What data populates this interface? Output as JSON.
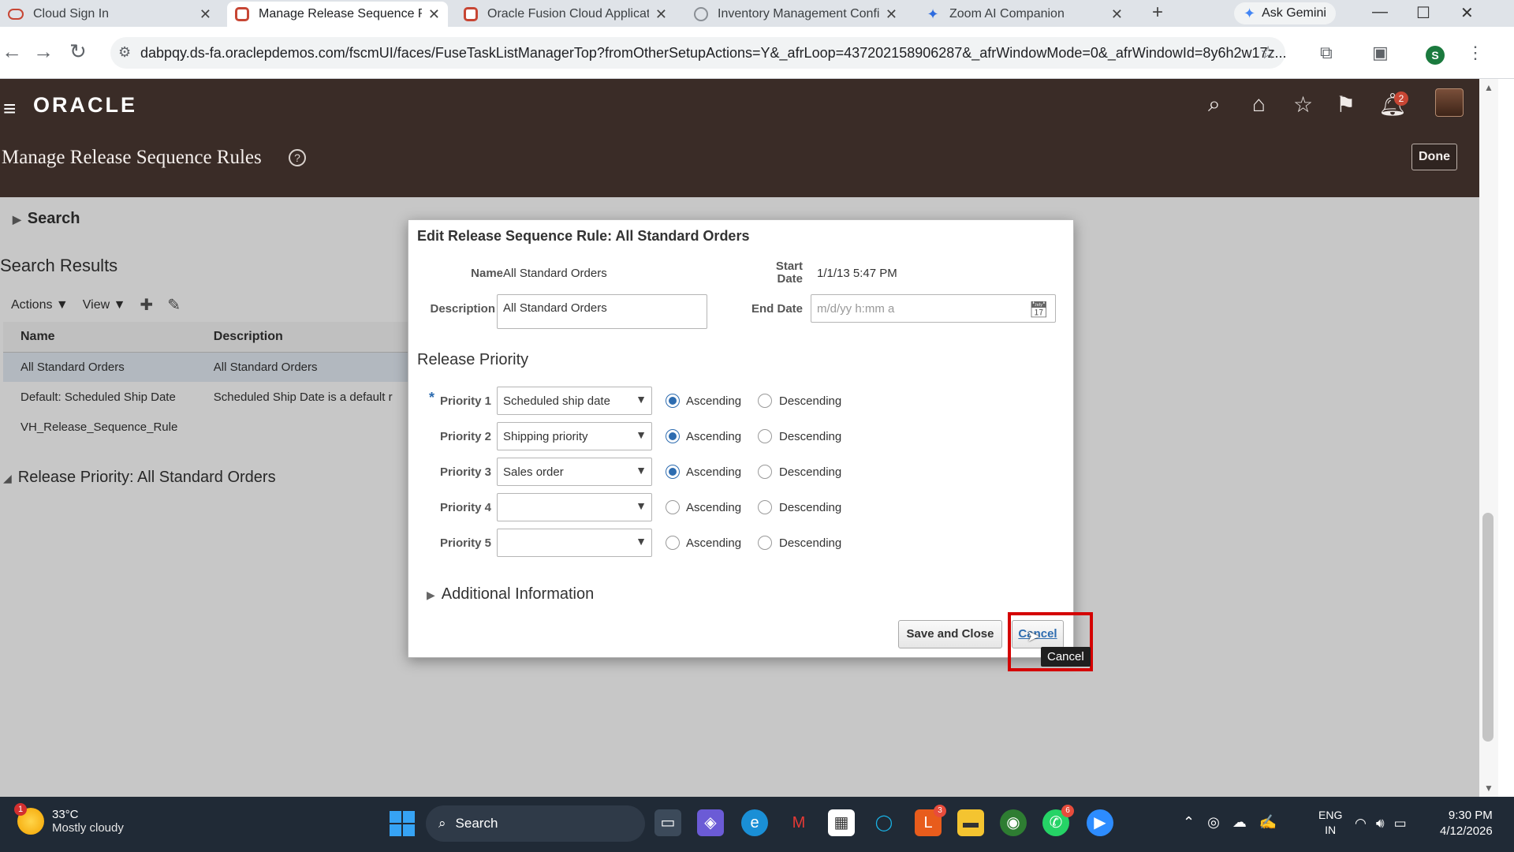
{
  "browser": {
    "tabs": [
      {
        "title": "Cloud Sign In",
        "icon": "cloud-icon",
        "active": false
      },
      {
        "title": "Manage Release Sequence Ru",
        "icon": "oracle-icon",
        "active": true
      },
      {
        "title": "Oracle Fusion Cloud Applicati",
        "icon": "oracle-icon",
        "active": false
      },
      {
        "title": "Inventory Management Config",
        "icon": "globe-icon",
        "active": false
      },
      {
        "title": "Zoom AI Companion",
        "icon": "zoom-icon",
        "active": false
      }
    ],
    "ask_gemini": "Ask Gemini",
    "url": "dabpqy.ds-fa.oraclepdemos.com/fscmUI/faces/FuseTaskListManagerTop?fromOtherSetupActions=Y&_afrLoop=437202158906287&_afrWindowMode=0&_afrWindowId=8y6h2w17z...",
    "profile_initial": "S"
  },
  "app": {
    "logo": "ORACLE",
    "page_title": "Manage Release Sequence Rules",
    "help": "?",
    "done_label": "Done",
    "notifications_count": "2"
  },
  "page": {
    "search_label": "Search",
    "results_label": "Search Results",
    "actions_label": "Actions ▼",
    "view_label": "View ▼",
    "columns": [
      "Name",
      "Description"
    ],
    "rows": [
      {
        "name": "All Standard Orders",
        "description": "All Standard Orders",
        "selected": true
      },
      {
        "name": "Default: Scheduled Ship Date",
        "description": "Scheduled Ship Date is a default r",
        "selected": false
      },
      {
        "name": "VH_Release_Sequence_Rule",
        "description": "",
        "selected": false
      }
    ],
    "release_priority_header": "Release Priority: All Standard Orders"
  },
  "dialog": {
    "title": "Edit Release Sequence Rule: All Standard Orders",
    "name_label": "Name",
    "name_value": "All Standard Orders",
    "start_date_label_1": "Start",
    "start_date_label_2": "Date",
    "start_date_value": "1/1/13 5:47 PM",
    "description_label": "Description",
    "description_value": "All Standard Orders",
    "end_date_label": "End Date",
    "end_date_placeholder": "m/d/yy h:mm a",
    "release_priority_title": "Release Priority",
    "ascending_label": "Ascending",
    "descending_label": "Descending",
    "priorities": [
      {
        "label": "Priority 1",
        "value": "Scheduled ship date",
        "order": "ascending",
        "required": true
      },
      {
        "label": "Priority 2",
        "value": "Shipping priority",
        "order": "ascending",
        "required": false
      },
      {
        "label": "Priority 3",
        "value": "Sales order",
        "order": "ascending",
        "required": false
      },
      {
        "label": "Priority 4",
        "value": "",
        "order": "none",
        "required": false
      },
      {
        "label": "Priority 5",
        "value": "",
        "order": "none",
        "required": false
      }
    ],
    "additional_info_label": "Additional Information",
    "save_close_label": "Save and Close",
    "cancel_label": "Cancel",
    "tooltip": "Cancel"
  },
  "taskbar": {
    "temperature": "33°C",
    "weather": "Mostly cloudy",
    "weather_alert": "1",
    "search_label": "Search",
    "lang_1": "ENG",
    "lang_2": "IN",
    "time": "9:30 PM",
    "date": "4/12/2026"
  },
  "colors": {
    "oracle_header": "#3a2c27",
    "accent_blue": "#2d6cb0",
    "highlight_red": "#d40000",
    "oracle_red": "#c74634"
  }
}
